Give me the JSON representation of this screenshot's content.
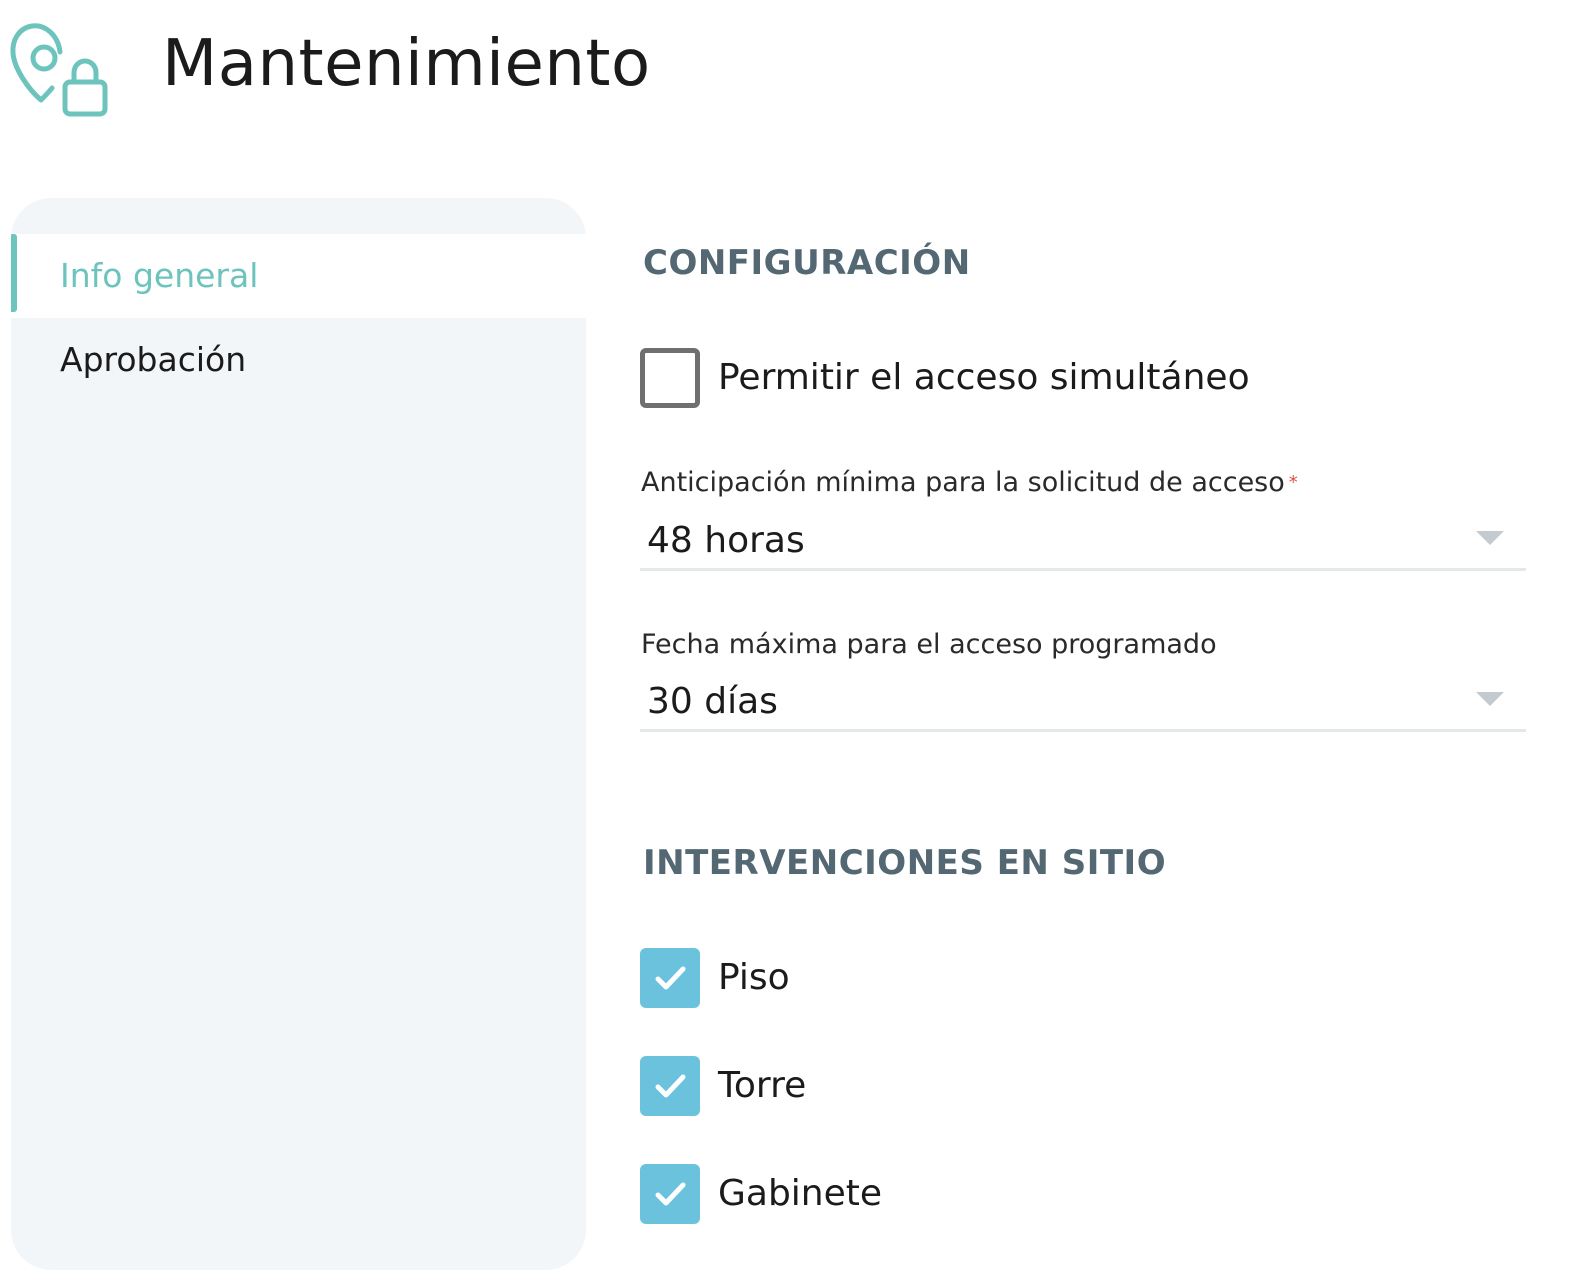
{
  "header": {
    "title": "Mantenimiento",
    "icon": "location-lock-icon",
    "icon_color": "#6cc4bd"
  },
  "sidebar": {
    "items": [
      {
        "label": "Info general",
        "active": true
      },
      {
        "label": "Aprobación",
        "active": false
      }
    ],
    "accent_color": "#6cc4bd"
  },
  "main": {
    "configuracion": {
      "heading": "CONFIGURACIÓN",
      "simultaneous_access": {
        "label": "Permitir el acceso simultáneo",
        "checked": false
      },
      "anticipation": {
        "label": "Anticipación mínima para la solicitud de acceso",
        "required_mark": "*",
        "value": "48 horas"
      },
      "max_date": {
        "label": "Fecha máxima para el acceso programado",
        "value": "30 días"
      }
    },
    "intervenciones": {
      "heading": "INTERVENCIONES EN SITIO",
      "options": [
        {
          "label": "Piso",
          "checked": true
        },
        {
          "label": "Torre",
          "checked": true
        },
        {
          "label": "Gabinete",
          "checked": true
        }
      ],
      "check_color": "#6ac2dc"
    }
  }
}
